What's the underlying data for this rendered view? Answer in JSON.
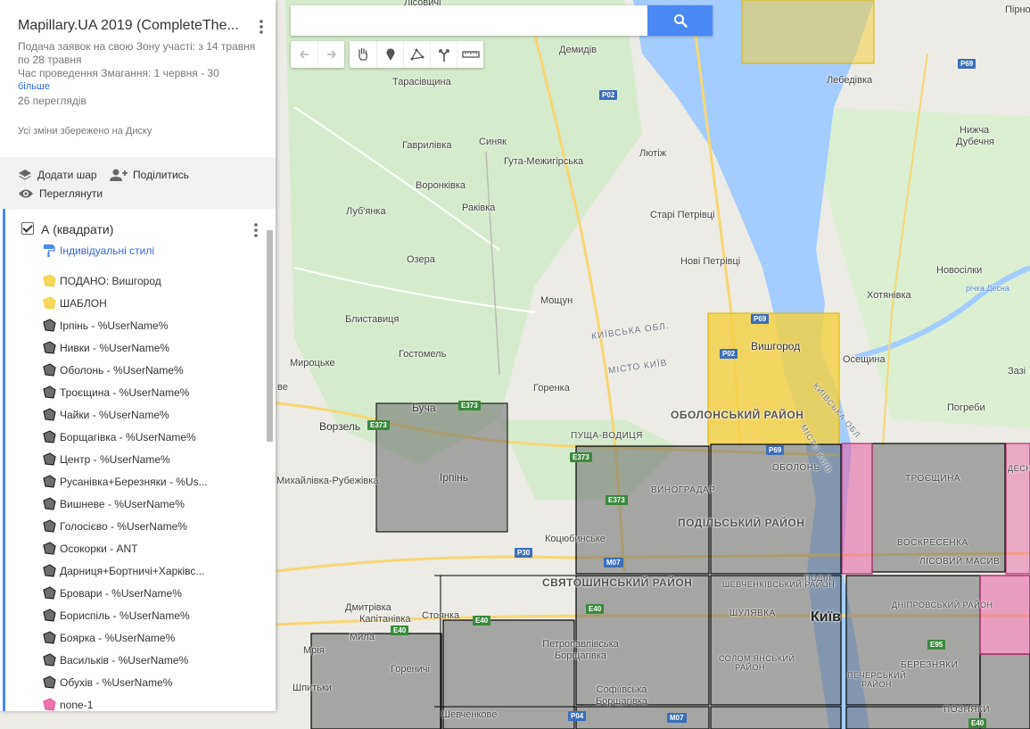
{
  "panel": {
    "title": "Mapillary.UA 2019 (CompleteThe...",
    "description_line1": "Подача заявок на свою Зону участі: з 14 травня по 28 травня",
    "description_line2": "Час проведення Змагання: 1 червня - 30",
    "more_link": "більше",
    "views": "26 переглядів",
    "saved_status": "Усі зміни збережено на Диску",
    "actions": {
      "add_layer": "Додати шар",
      "share": "Поділитись",
      "preview": "Переглянути"
    }
  },
  "layer": {
    "name": "А (квадрати)",
    "style_link": "Індивідуальні стилі",
    "features": [
      {
        "label": "ПОДАНО: Вишгород",
        "color": "#f4d03f"
      },
      {
        "label": "ШАБЛОН",
        "color": "#f4d03f"
      },
      {
        "label": "Ірпінь - %UserName%",
        "color": "#555555"
      },
      {
        "label": "Нивки - %UserName%",
        "color": "#555555"
      },
      {
        "label": "Оболонь - %UserName%",
        "color": "#555555"
      },
      {
        "label": "Троєщина - %UserName%",
        "color": "#555555"
      },
      {
        "label": "Чайки - %UserName%",
        "color": "#555555"
      },
      {
        "label": "Борщагівка - %UserName%",
        "color": "#555555"
      },
      {
        "label": "Центр - %UserName%",
        "color": "#555555"
      },
      {
        "label": "Русанівка+Березняки - %Us...",
        "color": "#555555"
      },
      {
        "label": "Вишневе - %UserName%",
        "color": "#555555"
      },
      {
        "label": "Голосієво - %UserName%",
        "color": "#555555"
      },
      {
        "label": "Осокорки - ANT",
        "color": "#555555"
      },
      {
        "label": "Дарниця+Бортничі+Харківс...",
        "color": "#555555"
      },
      {
        "label": "Бровари - %UserName%",
        "color": "#555555"
      },
      {
        "label": "Бориспіль - %UserName%",
        "color": "#555555"
      },
      {
        "label": "Боярка - %UserName%",
        "color": "#555555"
      },
      {
        "label": "Васильків - %UserName%",
        "color": "#555555"
      },
      {
        "label": "Обухів - %UserName%",
        "color": "#555555"
      },
      {
        "label": "none-1",
        "color": "#e85ca0"
      }
    ]
  },
  "map": {
    "places": {
      "lisovychi": "Лісовичі",
      "pirnove": "Пірнове",
      "demydiv": "Демидів",
      "tarasivshchyna": "Тарасівщина",
      "lebedivka": "Лебедівка",
      "havrylivka": "Гаврилівка",
      "syniak": "Синяк",
      "huta": "Гута-Межигірська",
      "liutizh": "Лютіж",
      "nyzhcha": "Нижча",
      "dubechnia": "Дубечня",
      "voronkivka": "Воронківка",
      "rakivka": "Раківка",
      "lubianka": "Луб'янка",
      "stari_petrivtsi": "Старі Петрівці",
      "ozera": "Озера",
      "novi_petrivtsi": "Нові Петрівці",
      "novosilky": "Новосілки",
      "khotianivka": "Хотянівка",
      "desna": "річка Десна",
      "moshchun": "Мощун",
      "blystavytsia": "Блиставиця",
      "vyshhorod": "Вишгород",
      "oseshchyna": "Осещина",
      "myrotske": "Мироцьке",
      "hostomel": "Гостомель",
      "hirenka": "Горенка",
      "pohreby": "Погреби",
      "kyiv_obl": "КИЇВСЬКА ОБЛ.",
      "misto_kyiv": "МІСТО КИЇВ",
      "buchа": "Буча",
      "vorzel": "Ворзель",
      "obolon_district": "ОБОЛОНСЬКИЙ РАЙОН",
      "pushcha": "ПУЩА-ВОДИЦЯ",
      "irpin": "Ірпінь",
      "mykhailivka": "Михайлівка-Рубежівка",
      "obolon": "ОБОЛОНЬ",
      "troieshchyna": "ТРОЄЩИНА",
      "vynohradar": "ВИНОГРАДАР",
      "podilskyi": "ПОДІЛЬСЬКИЙ РАЙОН",
      "voskresenka": "ВОСКРЕСЕНКА",
      "lisovyi": "ЛІСОВИЙ МАСИВ",
      "kotsiubynske": "Коцюбинське",
      "sviatoshynskyi": "СВЯТОШИНСЬКИЙ РАЙОН",
      "shevchenkivskyi": "ШЕВЧЕНКІВСЬКИЙ РАЙОН",
      "dniprovskyi": "ДНІПРОВСЬКИЙ РАЙОН",
      "dmytrivka": "Дмитрівка",
      "kapitanivka": "Капітанівка",
      "stoianka": "Стоянка",
      "shuliavka": "ШУЛЯВКА",
      "kyiv": "Київ",
      "mila": "Мила",
      "mriia": "Мрія",
      "horenychi": "Гореничі",
      "petropavlivska": "Петропавлівська Борщагівка",
      "solomianskyi": "СОЛОМ'ЯНСЬКИЙ РАЙОН",
      "pecherskyi": "ПЕЧЕРСЬКИЙ РАЙОН",
      "bereznyaky": "БЕРЕЗНЯКИ",
      "shpytky": "Шпитьки",
      "sofiivska": "Софіївська Борщагівка",
      "shevchenkove": "Шевченкове",
      "pozniaky": "ПОЗНЯКИ",
      "desnianskyi": "ДЕСНЯНСЬКИЙ РАЙОН",
      "podil": "ПОДІЛ",
      "ve": "ве",
      "kyivska_obl_rot": "КИЇВСЬКА ОБЛ",
      "misto_kyiv_rot": "МІСТО КИЇВ",
      "dniprovs": "Дніпро",
      "zaz": "Зазі"
    },
    "roads": {
      "p69a": "P69",
      "p02a": "P02",
      "p69b": "P69",
      "p02b": "P02",
      "e373a": "E373",
      "e373b": "E373",
      "e373c": "E373",
      "p69c": "P69",
      "e373d": "E373",
      "p30": "P30",
      "m07a": "M07",
      "e40a": "E40",
      "e40b": "E40",
      "e40c": "E40",
      "e95": "E95",
      "m07b": "M07",
      "p04": "P04",
      "e40d": "E40"
    },
    "polygon_colors": {
      "water": "#a3ccff",
      "yellow": "#f4d03f",
      "gray": "#6b6b6b",
      "pink": "#e85ca0",
      "green_park": "#cde8c4"
    }
  }
}
